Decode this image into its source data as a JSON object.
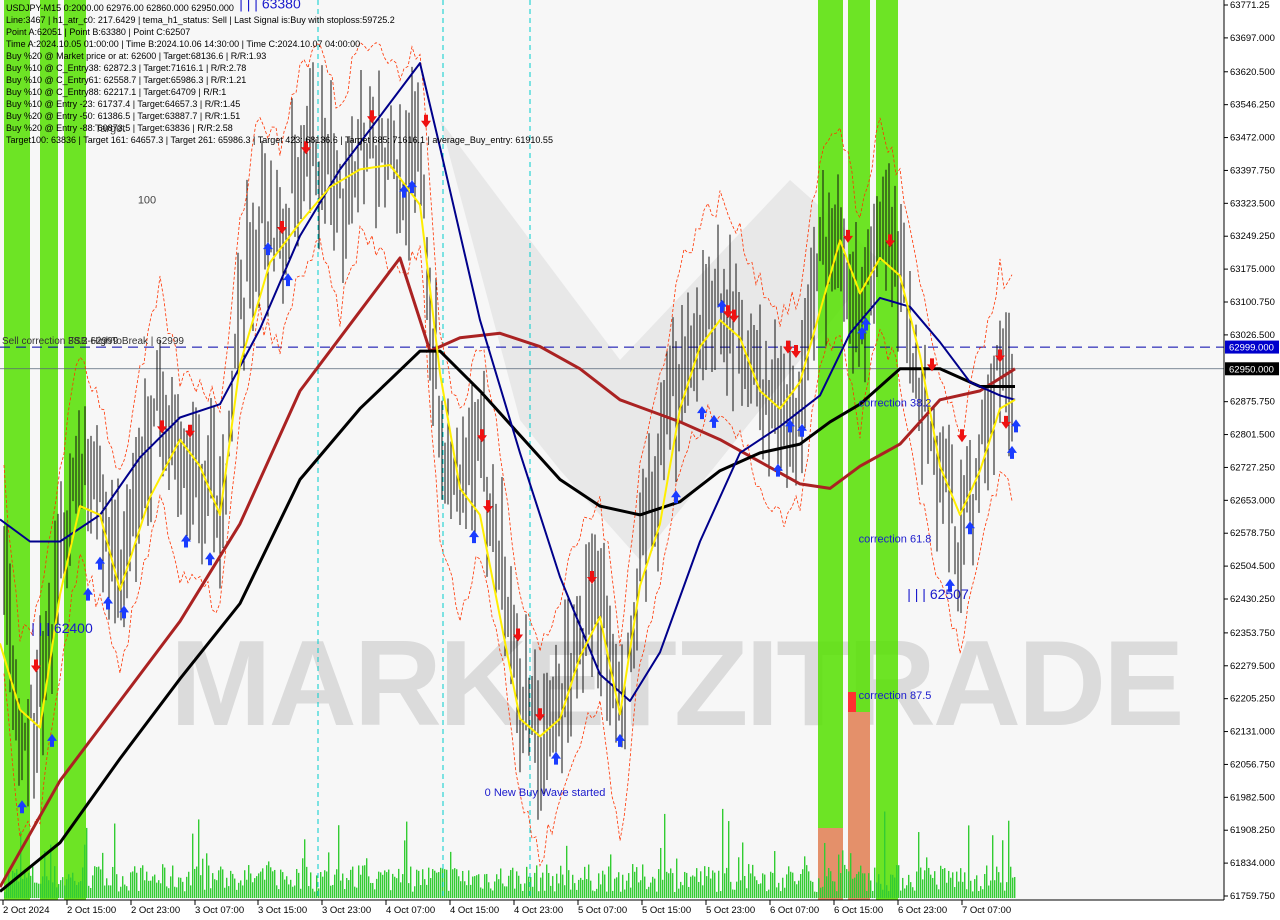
{
  "info_lines": [
    "USDJPY-M15 0:2000.00 62976.00 62860.000 62950.000",
    "Line:3467 | h1_atr_c0: 217.6429 | tema_h1_status: Sell | Last Signal is:Buy with stoploss:59725.2",
    "Point A:62051 | Point B:63380 | Point C:62507",
    "Time A:2024.10.05 01:00:00 | Time B:2024.10.06 14:30:00 | Time C:2024.10.07 04:00:00",
    "Buy %20 @ Market price or at: 62600 | Target:68136.6 | R/R:1.93",
    "Buy %10 @ C_Entry38: 62872.3 | Target:71616.1 | R/R:2.78",
    "Buy %10 @ C_Entry61: 62558.7 | Target:65986.3 | R/R:1.21",
    "Buy %10 @ C_Entry88: 62217.1 | Target:64709 | R/R:1",
    "Buy %10 @ Entry -23: 61737.4 | Target:64657.3 | R/R:1.45",
    "Buy %20 @ Entry -50: 61386.5 | Target:63887.7 | R/R:1.51",
    "Buy %20 @ Entry -88: 60873.5 | Target:63836 | R/R:2.58",
    "Target100: 63836 | Target 161: 64657.3 | Target 261: 65986.3 | Target 423: 68136.6 | Target 685: 71616.1 | average_Buy_entry: 61910.55"
  ],
  "chart_data": {
    "type": "candlestick",
    "ylim": [
      61759.75,
      63771.25
    ],
    "y_ticks": [
      "63771.25",
      "63697.000",
      "63620.500",
      "63546.250",
      "63472.000",
      "63397.750",
      "63323.500",
      "63249.250",
      "63175.000",
      "63100.750",
      "63026.500",
      "62875.750",
      "62801.500",
      "62727.250",
      "62653.000",
      "62578.750",
      "62504.500",
      "62430.250",
      "62353.750",
      "62279.500",
      "62205.250",
      "62131.000",
      "62056.750",
      "61982.500",
      "61908.250",
      "61834.000",
      "61759.750"
    ],
    "x_ticks": [
      "2 Oct 2024",
      "2 Oct 15:00",
      "2 Oct 23:00",
      "3 Oct 07:00",
      "3 Oct 15:00",
      "3 Oct 23:00",
      "4 Oct 07:00",
      "4 Oct 15:00",
      "4 Oct 23:00",
      "5 Oct 07:00",
      "5 Oct 15:00",
      "5 Oct 23:00",
      "6 Oct 07:00",
      "6 Oct 15:00",
      "6 Oct 23:00",
      "7 Oct 07:00"
    ],
    "price_labels": [
      {
        "value": 62999.0,
        "text": "62999.000",
        "bg": "#0000cc"
      },
      {
        "value": 62950.0,
        "text": "62950.000",
        "bg": "#000000"
      }
    ],
    "hlines": [
      {
        "value": 62999.0,
        "label": "Sell correction 38.2 62999",
        "label2": "FSB-HighToBreak | 62999"
      },
      {
        "value": 62950.0
      }
    ],
    "annotations": [
      {
        "text": "Target",
        "x": 110,
        "price": 63485
      },
      {
        "text": "100",
        "x": 147,
        "price": 63323
      },
      {
        "text": "| | | 62400",
        "x": 62,
        "price": 62353
      },
      {
        "text": "| | | 63380",
        "x": 270,
        "price": 63763
      },
      {
        "text": "0 New Buy Wave started",
        "x": 545,
        "price": 61985
      },
      {
        "text": "correction 38.2",
        "x": 895,
        "price": 62865
      },
      {
        "text": "correction 61.8",
        "x": 895,
        "price": 62558
      },
      {
        "text": "| | | 62507",
        "x": 938,
        "price": 62430
      },
      {
        "text": "correction 87.5",
        "x": 895,
        "price": 62205
      }
    ],
    "watermark": "MARKETZITRADE",
    "series": [
      {
        "name": "",
        "color": "#000000",
        "values": [
          62598.5,
          62582.7,
          62559.6,
          62554.0,
          62574.0,
          62620.3,
          62627.8,
          62643.1,
          62636.7,
          62635.0,
          62709.2,
          62711.7,
          62704.4,
          62704.3,
          62751.0,
          62728.2,
          62826.6,
          62839.0,
          62832.5,
          62893.2,
          62904.4,
          62900.4,
          62895.7,
          62931.1,
          62925.2,
          62903.1,
          62920.3,
          62945.7,
          62998.2,
          63017.2,
          63027.0,
          62960.1,
          62882.7,
          62907.5,
          62878.8,
          62876.8,
          62877.6,
          62946.9,
          62900.6,
          62866.4,
          62855.9,
          62837.5,
          62824.1,
          62795.6,
          62792.9,
          62736.2,
          62751.4,
          62780.5,
          62766.3,
          62768.1,
          62765.7,
          62753.3,
          62730.0,
          62723.9,
          62711.1,
          62707.5,
          62696.7,
          62680.7,
          62692.6,
          62652.9,
          62658.8,
          62654.4,
          62611.6,
          62610.2,
          62609.4,
          62635.5,
          62662.1,
          62717.6,
          62779.1,
          62790.6,
          62790.4,
          62814.8,
          62844.0,
          62888.4,
          62915.8,
          62937.2,
          62961.5,
          62998.5,
          62970.9,
          62938.7,
          62953.0,
          62981.6,
          62977.9,
          63012.7,
          63018.9,
          63000.3,
          62936.7,
          62917.2,
          62899.4,
          62956.1,
          62955.5,
          62987.8,
          62915.3,
          62912.3,
          62895.0,
          62891.4,
          62885.1,
          62835.8,
          62819.2,
          62831.7,
          62822.1,
          62855.2,
          62863.0,
          62887.3,
          62882.3,
          62910.0,
          62917.9,
          62932.7,
          62975.6,
          62995.3,
          63037.1,
          62966.3,
          63009.5,
          63030.1,
          63078.7,
          63049.0,
          63016.1,
          63011.3,
          63001.4,
          63003.5,
          62985.1,
          62989.8,
          62958.5,
          62936.3,
          62901.0,
          62911.3,
          62928.4,
          62946.0,
          62924.6,
          62939.2,
          62941.0,
          62977.5,
          62964.7,
          63000.3,
          63029.3,
          63014.8,
          63055.1,
          63103.9,
          63080.2,
          63113.2,
          63117.7,
          63149.9,
          63135.3,
          63160.4,
          63137.0,
          63137.7,
          63164.0,
          63226.0,
          63196.2,
          63208.6,
          63243.7,
          63272.8,
          63258.4,
          63246.5,
          63300.7,
          63380.0,
          63315.8,
          63336.3,
          63344.4,
          63292.8,
          63300.9,
          63296.3,
          63260.9,
          63264.1,
          63306.4,
          63299.2,
          63331.5,
          63283.3,
          63250.8,
          63236.6,
          63253.3,
          63215.9,
          63227.0,
          63243.2,
          63271.8,
          63294.7,
          63287.0,
          63240.6,
          63215.8,
          63181.0,
          63140.2,
          63118.1,
          63074.3,
          63036.1,
          63024.1,
          63003.8,
          62984.0,
          62980.4,
          62961.3,
          62952.5,
          62935.3,
          62940.5,
          62939.6,
          62950.0
        ]
      }
    ],
    "candles_url_note": ""
  }
}
